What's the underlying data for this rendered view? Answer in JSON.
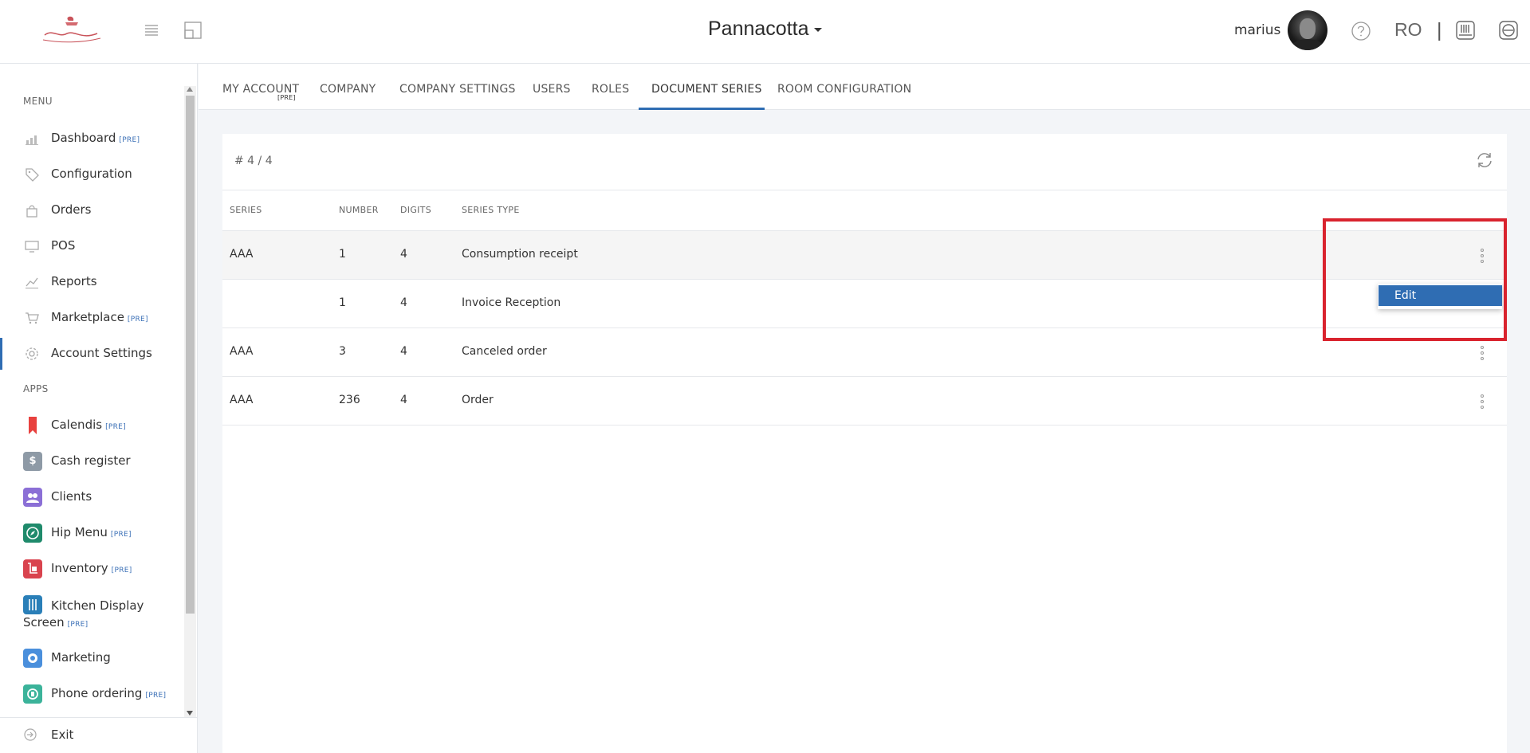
{
  "header": {
    "company_name": "Pannacotta",
    "username": "marius",
    "language": "RO",
    "separator": "|"
  },
  "sidebar": {
    "menu_label": "MENU",
    "apps_label": "APPS",
    "pre_badge": "[PRE]",
    "menu_items": [
      {
        "label": "Dashboard",
        "pre": "[PRE]",
        "icon": "chart-icon"
      },
      {
        "label": "Configuration",
        "pre": "",
        "icon": "tag-icon"
      },
      {
        "label": "Orders",
        "pre": "",
        "icon": "bag-icon"
      },
      {
        "label": "POS",
        "pre": "",
        "icon": "monitor-icon"
      },
      {
        "label": "Reports",
        "pre": "",
        "icon": "line-chart-icon"
      },
      {
        "label": "Marketplace",
        "pre": "[PRE]",
        "icon": "cart-icon"
      },
      {
        "label": "Account Settings",
        "pre": "",
        "icon": "gear-icon"
      }
    ],
    "apps": [
      {
        "label": "Calendis",
        "pre": "[PRE]",
        "color": "#e8413e"
      },
      {
        "label": "Cash register",
        "pre": "",
        "color": "#8e9aa6"
      },
      {
        "label": "Clients",
        "pre": "",
        "color": "#8b6fd6"
      },
      {
        "label": "Hip Menu",
        "pre": "[PRE]",
        "color": "#1f8a6b"
      },
      {
        "label": "Inventory",
        "pre": "[PRE]",
        "color": "#d9434e"
      },
      {
        "label": "Kitchen Display",
        "label2": "Screen",
        "pre": "[PRE]",
        "color": "#2a7fb8"
      },
      {
        "label": "Marketing",
        "pre": "",
        "color": "#4a8fdc"
      },
      {
        "label": "Phone ordering",
        "pre": "[PRE]",
        "color": "#3bb39a"
      }
    ],
    "exit_label": "Exit"
  },
  "tabs": {
    "items": [
      "MY ACCOUNT",
      "COMPANY",
      "COMPANY SETTINGS",
      "USERS",
      "ROLES",
      "DOCUMENT SERIES",
      "ROOM CONFIGURATION"
    ],
    "my_account_pre": "[PRE]",
    "active": "DOCUMENT SERIES"
  },
  "table": {
    "count": "# 4 / 4",
    "columns": [
      "SERIES",
      "NUMBER",
      "DIGITS",
      "SERIES TYPE"
    ],
    "rows": [
      {
        "series": "AAA",
        "number": "1",
        "digits": "4",
        "type": "Consumption receipt"
      },
      {
        "series": "",
        "number": "1",
        "digits": "4",
        "type": "Invoice Reception"
      },
      {
        "series": "AAA",
        "number": "3",
        "digits": "4",
        "type": "Canceled order"
      },
      {
        "series": "AAA",
        "number": "236",
        "digits": "4",
        "type": "Order"
      }
    ]
  },
  "dropdown": {
    "edit_label": "Edit"
  },
  "colors": {
    "accent": "#2f6db3",
    "highlight": "#d9232e"
  }
}
